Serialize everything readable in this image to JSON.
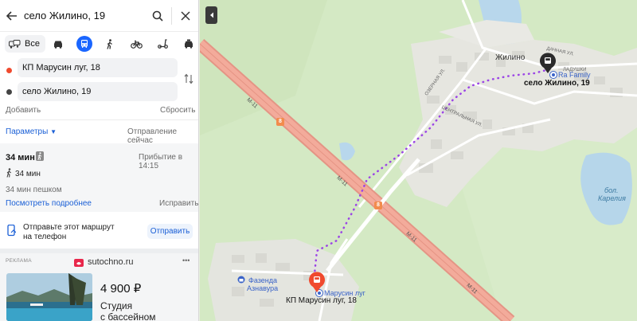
{
  "search": {
    "query": "село Жилино, 19"
  },
  "modes": {
    "all_label": "Все"
  },
  "route": {
    "from": "КП Марусин луг, 18",
    "to": "село Жилино, 19",
    "add_label": "Добавить",
    "reset_label": "Сбросить",
    "params_label": "Параметры",
    "departure_label": "Отправление сейчас",
    "duration": "34 мин",
    "arrival": "Прибытие в 14:15",
    "walk_duration": "34 мин",
    "walk_summary": "34 мин пешком",
    "details_label": "Посмотреть подробнее",
    "fix_label": "Исправить"
  },
  "send": {
    "text_line1": "Отправьте этот маршрут",
    "text_line2": "на телефон",
    "button_label": "Отправить"
  },
  "ad": {
    "tag": "РЕКЛАМА",
    "brand": "sutochno.ru",
    "more": "•••",
    "price": "4 900 ₽",
    "title_line1": "Студия",
    "title_line2": "с бассейном"
  },
  "map": {
    "labels": {
      "village": "Жилино",
      "dest": "село Жилино, 19",
      "ra_family": "Ra Family",
      "origin": "КП Марусин луг, 18",
      "marusin": "Марусин луг",
      "fazenda_1": "Фазенда",
      "fazenda_2": "Азнавура",
      "lake_1": "бол.",
      "lake_2": "Карелия",
      "dachnaya": "ДАЧНАЯ УЛ.",
      "ladushki": "ЛАДУШКИ",
      "ozernaya": "ОЗЕРНАЯ УЛ.",
      "centralnaya": "ЦЕНТРАЛЬНАЯ УЛ.",
      "m11": "М-11",
      "shield_num": "8"
    }
  },
  "colors": {
    "accent": "#1a66ff",
    "route": "#9b44e6",
    "forest": "#d4e9c4",
    "highway": "#f0a493",
    "origin_dot": "#f04a2e"
  }
}
